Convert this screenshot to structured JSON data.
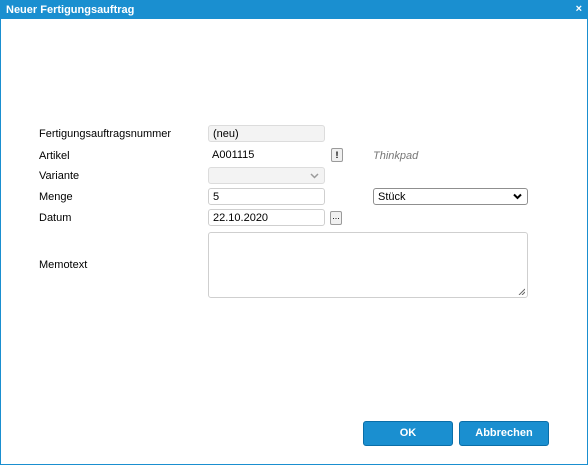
{
  "window": {
    "title": "Neuer Fertigungsauftrag",
    "close_label": "×"
  },
  "form": {
    "order_number": {
      "label": "Fertigungsauftragsnummer",
      "value": "(neu)"
    },
    "article": {
      "label": "Artikel",
      "value": "A001115",
      "lookup_button": "!",
      "description": "Thinkpad"
    },
    "variant": {
      "label": "Variante",
      "value": ""
    },
    "quantity": {
      "label": "Menge",
      "value": "5",
      "unit": "Stück"
    },
    "date": {
      "label": "Datum",
      "value": "22.10.2020",
      "picker_button": "..."
    },
    "memo": {
      "label": "Memotext",
      "value": ""
    }
  },
  "buttons": {
    "ok_label": "OK",
    "cancel_label": "Abbrechen"
  },
  "colors": {
    "accent": "#1a8fd0"
  }
}
